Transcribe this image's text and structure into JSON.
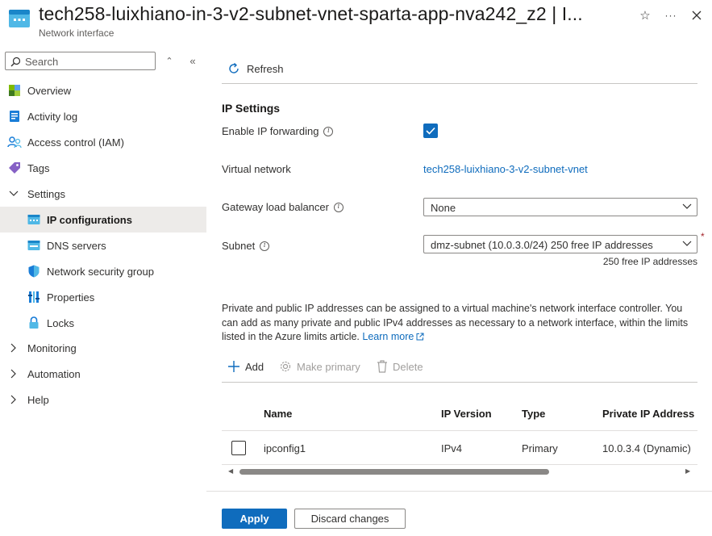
{
  "header": {
    "title": "tech258-luixhiano-in-3-v2-subnet-vnet-sparta-app-nva242_z2 | I...",
    "subtitle": "Network interface",
    "icons": [
      "network-interface-icon",
      "star-icon",
      "more-icon",
      "close-icon"
    ]
  },
  "sidebar": {
    "search_placeholder": "Search",
    "items": [
      {
        "label": "Overview",
        "icon": "overview-icon"
      },
      {
        "label": "Activity log",
        "icon": "activity-log-icon"
      },
      {
        "label": "Access control (IAM)",
        "icon": "iam-icon"
      },
      {
        "label": "Tags",
        "icon": "tag-icon"
      },
      {
        "label": "Settings",
        "icon": "chevron-down-icon"
      },
      {
        "label": "IP configurations",
        "icon": "ip-config-icon",
        "selected": true
      },
      {
        "label": "DNS servers",
        "icon": "dns-icon"
      },
      {
        "label": "Network security group",
        "icon": "shield-icon"
      },
      {
        "label": "Properties",
        "icon": "properties-icon"
      },
      {
        "label": "Locks",
        "icon": "lock-icon"
      },
      {
        "label": "Monitoring",
        "icon": "chevron-right-icon"
      },
      {
        "label": "Automation",
        "icon": "chevron-right-icon"
      },
      {
        "label": "Help",
        "icon": "chevron-right-icon"
      }
    ]
  },
  "toolbar": {
    "refresh_label": "Refresh"
  },
  "ip_settings": {
    "title": "IP Settings",
    "enable_forwarding_label": "Enable IP forwarding",
    "enable_forwarding_checked": true,
    "virtual_network_label": "Virtual network",
    "virtual_network_value": "tech258-luixhiano-3-v2-subnet-vnet",
    "gateway_lb_label": "Gateway load balancer",
    "gateway_lb_value": "None",
    "subnet_label": "Subnet",
    "subnet_value": "dmz-subnet (10.0.3.0/24) 250 free IP addresses",
    "subnet_required": "*",
    "subnet_hint": "250 free IP addresses"
  },
  "description": {
    "text": "Private and public IP addresses can be assigned to a virtual machine's network interface controller. You can add as many private and public IPv4 addresses as necessary to a network interface, within the limits listed in the Azure limits article.",
    "learn_more": "Learn more"
  },
  "actions": {
    "add": "Add",
    "make_primary": "Make primary",
    "delete": "Delete"
  },
  "grid": {
    "columns": [
      "Name",
      "IP Version",
      "Type",
      "Private IP Address"
    ],
    "rows": [
      {
        "name": "ipconfig1",
        "ip_version": "IPv4",
        "type": "Primary",
        "private_ip": "10.0.3.4 (Dynamic)"
      }
    ]
  },
  "footer": {
    "apply": "Apply",
    "discard": "Discard changes"
  },
  "colors": {
    "accent": "#0f6cbd",
    "selected_bg": "#edebe9",
    "required": "#a4262c"
  }
}
